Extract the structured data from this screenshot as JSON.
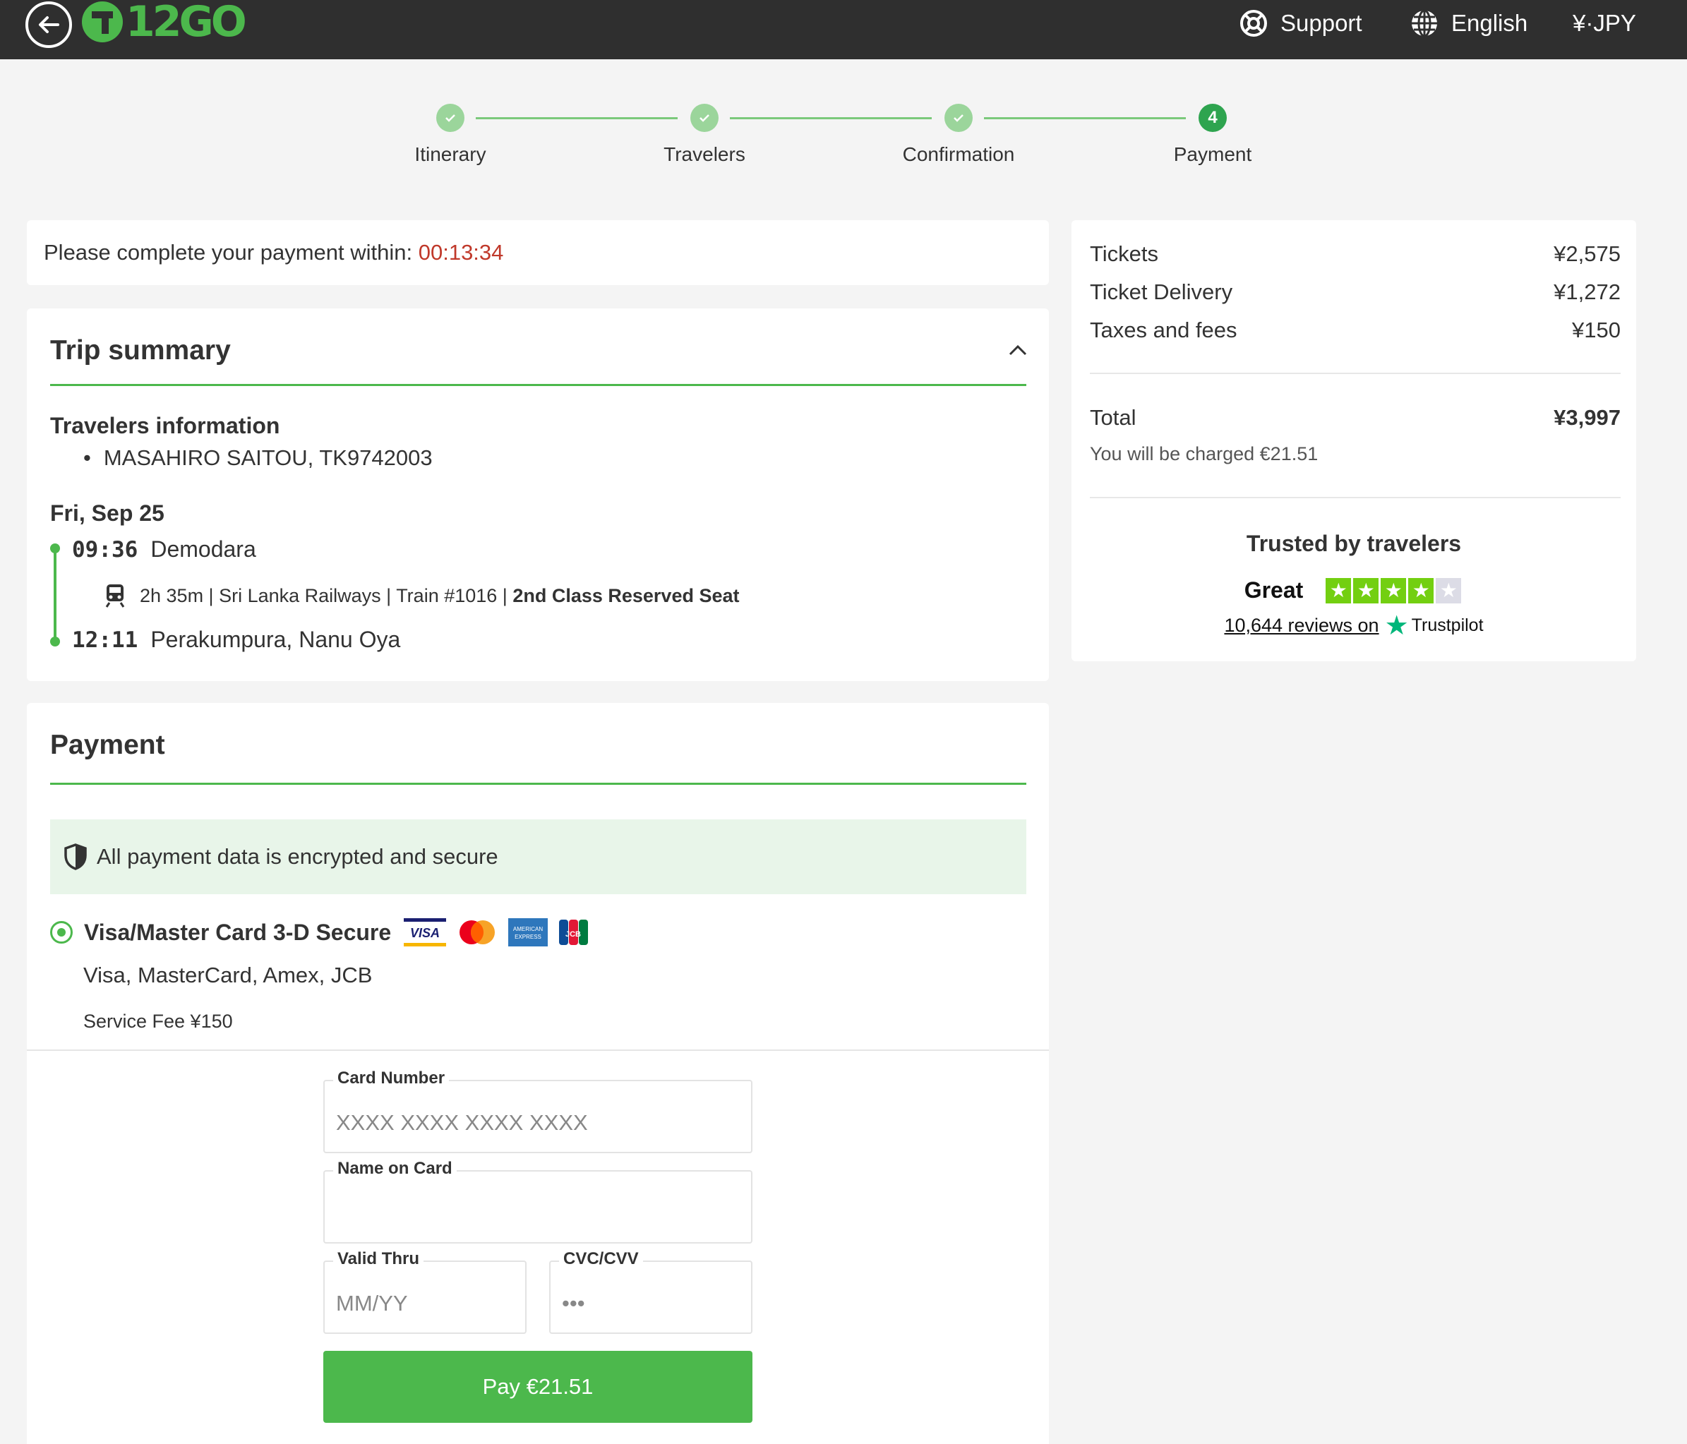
{
  "header": {
    "logo": "12GO",
    "support": "Support",
    "language": "English",
    "currency": "¥·JPY"
  },
  "steps": [
    {
      "label": "Itinerary",
      "state": "done"
    },
    {
      "label": "Travelers",
      "state": "done"
    },
    {
      "label": "Confirmation",
      "state": "done"
    },
    {
      "label": "Payment",
      "state": "active",
      "number": "4"
    }
  ],
  "timer": {
    "text": "Please complete your payment within:",
    "value": "00:13:34"
  },
  "trip": {
    "title": "Trip summary",
    "travelers_heading": "Travelers information",
    "traveler": "MASAHIRO SAITOU, TK9742003",
    "date": "Fri, Sep 25",
    "departure": {
      "time": "09:36",
      "station": "Demodara"
    },
    "leg": {
      "info": "2h 35m | Sri Lanka Railways | Train #1016 |",
      "class": "2nd Class Reserved Seat"
    },
    "arrival": {
      "time": "12:11",
      "station": "Perakumpura, Nanu Oya"
    }
  },
  "payment": {
    "title": "Payment",
    "secure_text": "All payment data is encrypted and secure",
    "method_label": "Visa/Master Card 3-D Secure",
    "method_sub": "Visa, MasterCard, Amex, JCB",
    "service_fee": "Service Fee ¥150",
    "card_logos": [
      "VISA",
      "MasterCard",
      "AMERICAN EXPRESS",
      "JCB"
    ],
    "fields": {
      "card_number_label": "Card Number",
      "card_number_placeholder": "XXXX XXXX XXXX XXXX",
      "name_label": "Name on Card",
      "name_placeholder": "",
      "valid_label": "Valid Thru",
      "valid_placeholder": "MM/YY",
      "cvc_label": "CVC/CVV",
      "cvc_placeholder": "•••"
    },
    "pay_button": "Pay  €21.51"
  },
  "summary": {
    "rows": [
      {
        "label": "Tickets",
        "value": "¥2,575"
      },
      {
        "label": "Ticket Delivery",
        "value": "¥1,272"
      },
      {
        "label": "Taxes and fees",
        "value": "¥150"
      }
    ],
    "total_label": "Total",
    "total_value": "¥3,997",
    "charged": "You will be charged €21.51",
    "trusted": "Trusted by travelers",
    "rating_word": "Great",
    "stars_filled": 4,
    "stars_total": 5,
    "reviews": "10,644 reviews on",
    "trustpilot": "Trustpilot"
  },
  "colors": {
    "brand_green": "#4cb84c",
    "header_bg": "#2f2f2f",
    "timer_red": "#c0392b",
    "trustpilot_green": "#00b67a"
  }
}
